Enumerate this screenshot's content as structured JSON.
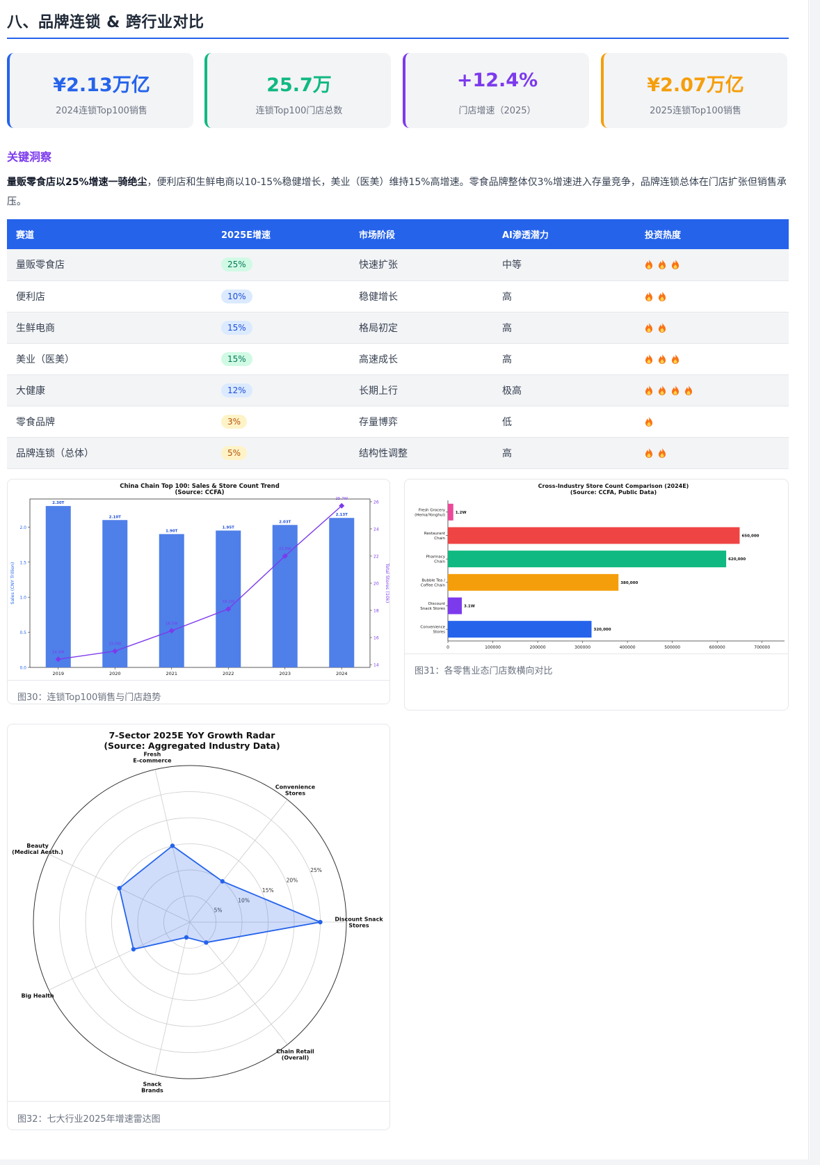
{
  "section_title": "八、品牌连锁 & 跨行业对比",
  "kpis": [
    {
      "value": "¥2.13万亿",
      "label": "2024连锁Top100销售",
      "color": "#2563eb"
    },
    {
      "value": "25.7万",
      "label": "连锁Top100门店总数",
      "color": "#10b981"
    },
    {
      "value": "+12.4%",
      "label": "门店增速（2025）",
      "color": "#7c3aed"
    },
    {
      "value": "¥2.07万亿",
      "label": "2025连锁Top100销售",
      "color": "#f59e0b"
    }
  ],
  "insight": {
    "title": "关键洞察",
    "bold": "量贩零食店以25%增速一骑绝尘",
    "text": "，便利店和生鲜电商以10-15%稳健增长，美业（医美）维持15%高增速。零食品牌整体仅3%增速进入存量竞争，品牌连锁总体在门店扩张但销售承压。"
  },
  "table": {
    "headers": [
      "赛道",
      "2025E增速",
      "市场阶段",
      "AI渗透潜力",
      "投资热度"
    ],
    "rows": [
      {
        "track": "量贩零食店",
        "growth": "25%",
        "growth_color": "green",
        "stage": "快速扩张",
        "ai": "中等",
        "heat": 3
      },
      {
        "track": "便利店",
        "growth": "10%",
        "growth_color": "blue",
        "stage": "稳健增长",
        "ai": "高",
        "heat": 2
      },
      {
        "track": "生鲜电商",
        "growth": "15%",
        "growth_color": "blue",
        "stage": "格局初定",
        "ai": "高",
        "heat": 2
      },
      {
        "track": "美业（医美）",
        "growth": "15%",
        "growth_color": "green",
        "stage": "高速成长",
        "ai": "高",
        "heat": 3
      },
      {
        "track": "大健康",
        "growth": "12%",
        "growth_color": "blue",
        "stage": "长期上行",
        "ai": "极高",
        "heat": 4
      },
      {
        "track": "零食品牌",
        "growth": "3%",
        "growth_color": "yellow",
        "stage": "存量博弈",
        "ai": "低",
        "heat": 1
      },
      {
        "track": "品牌连锁（总体）",
        "growth": "5%",
        "growth_color": "yellow",
        "stage": "结构性调整",
        "ai": "高",
        "heat": 2
      }
    ]
  },
  "figures": {
    "fig30_caption": "图30：连锁Top100销售与门店趋势",
    "fig31_caption": "图31：各零售业态门店数横向对比",
    "fig32_caption": "图32：七大行业2025年增速雷达图"
  },
  "chart_data": [
    {
      "type": "bar",
      "title": "China Chain Top 100: Sales & Store Count Trend",
      "subtitle": "(Source: CCFA)",
      "categories": [
        "2019",
        "2020",
        "2021",
        "2022",
        "2023",
        "2024"
      ],
      "ylabel": "Sales (CNY Trillion)",
      "y2label": "Total Stores (10k)",
      "ylim": [
        0,
        2.4
      ],
      "y2lim": [
        13.8,
        26.2
      ],
      "yticks": [
        "0.0",
        "0.5",
        "1.0",
        "1.5",
        "2.0"
      ],
      "y2ticks": [
        "14",
        "16",
        "18",
        "20",
        "22",
        "24",
        "26"
      ],
      "series": [
        {
          "kind": "bar",
          "values": [
            2.3,
            2.1,
            1.9,
            1.95,
            2.03,
            2.13
          ],
          "labels": [
            "2.30T",
            "2.10T",
            "1.90T",
            "1.95T",
            "2.03T",
            "2.13T"
          ],
          "color": "#4f7fe8"
        },
        {
          "kind": "line",
          "values": [
            14.4,
            15.0,
            16.5,
            18.1,
            22.0,
            25.7
          ],
          "labels": [
            "14.4W",
            "15.0W",
            "16.5W",
            "18.1W",
            "22.0W",
            "25.7W"
          ],
          "color": "#7c3aed"
        }
      ]
    },
    {
      "type": "bar",
      "orientation": "horizontal",
      "title": "Cross-Industry Store Count Comparison (2024E)",
      "subtitle": "(Source: CCFA, Public Data)",
      "categories": [
        "Fresh Grocery (Hema/Yonghui)",
        "Restaurant Chain",
        "Pharmacy Chain",
        "Bubble Tea / Coffee Chain",
        "Discount Snack Stores",
        "Convenience Stores"
      ],
      "category_lines": [
        [
          "Fresh Grocery",
          "(Hema/Yonghui)"
        ],
        [
          "Restaurant",
          "Chain"
        ],
        [
          "Pharmacy",
          "Chain"
        ],
        [
          "Bubble Tea /",
          "Coffee Chain"
        ],
        [
          "Discount",
          "Snack Stores"
        ],
        [
          "Convenience",
          "Stores"
        ]
      ],
      "values": [
        12000,
        650000,
        620000,
        380000,
        31000,
        320000
      ],
      "value_labels": [
        "1.2W",
        "650,000",
        "620,000",
        "380,000",
        "3.1W",
        "320,000"
      ],
      "colors": [
        "#ec4899",
        "#ef4444",
        "#10b981",
        "#f59e0b",
        "#7c3aed",
        "#2563eb"
      ],
      "xlim": [
        0,
        750000
      ],
      "xticks": [
        "0",
        "100000",
        "200000",
        "300000",
        "400000",
        "500000",
        "600000",
        "700000"
      ]
    },
    {
      "type": "radar",
      "title": "7-Sector 2025E YoY Growth Radar",
      "subtitle": "(Source: Aggregated Industry Data)",
      "axes": [
        [
          "Discount Snack",
          "Stores"
        ],
        [
          "Convenience",
          "Stores"
        ],
        [
          "Fresh",
          "E-commerce"
        ],
        [
          "Beauty",
          "(Medical Aesth.)"
        ],
        [
          "Big Health"
        ],
        [
          "Snack",
          "Brands"
        ],
        [
          "Chain Retail",
          "(Overall)"
        ]
      ],
      "values": [
        25,
        10,
        15,
        15,
        12,
        3,
        5
      ],
      "rmax": 30,
      "rticks": [
        "5%",
        "10%",
        "15%",
        "20%",
        "25%"
      ],
      "color": "#2563eb"
    }
  ]
}
